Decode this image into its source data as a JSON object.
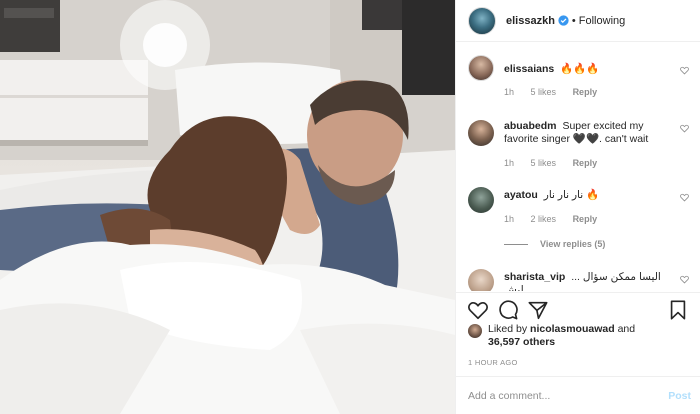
{
  "header": {
    "username": "elissazkh",
    "separator": "•",
    "follow_state": "Following"
  },
  "comments": [
    {
      "username": "elissaians",
      "text": "🔥🔥🔥",
      "time": "1h",
      "likes": "5 likes",
      "reply": "Reply"
    },
    {
      "username": "abuabedm",
      "text": "Super excited my favorite singer 🖤🖤. can't wait",
      "time": "1h",
      "likes": "5 likes",
      "reply": "Reply"
    },
    {
      "username": "ayatou",
      "text": "نار نار نار 🔥",
      "time": "1h",
      "likes": "2 likes",
      "reply": "Reply"
    },
    {
      "username": "sharista_vip",
      "text": "اليسا ممكن سؤال ... ليش",
      "time": "",
      "likes": "",
      "reply": ""
    }
  ],
  "view_replies": "View replies (5)",
  "likes": {
    "prefix": "Liked by",
    "user": "nicolasmouawad",
    "joiner": "and",
    "others": "36,597 others"
  },
  "timestamp": "1 HOUR AGO",
  "add_comment": {
    "placeholder": "Add a comment...",
    "post_label": "Post"
  },
  "colors": {
    "text": "#262626",
    "muted": "#8e8e8e",
    "verified": "#3897f0",
    "post_disabled": "#b2dffc",
    "border": "#efefef"
  },
  "icons": [
    "verified-badge-icon",
    "heart-icon",
    "comment-icon",
    "share-icon",
    "bookmark-icon",
    "heart-small-icon"
  ]
}
